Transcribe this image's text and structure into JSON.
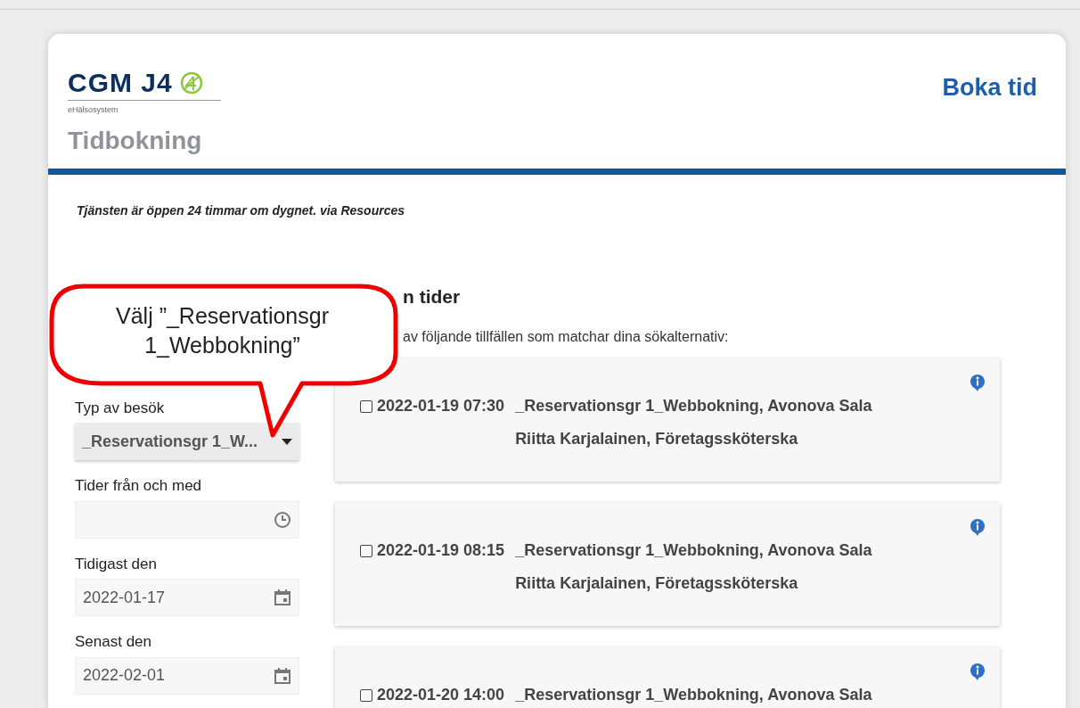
{
  "header": {
    "logo_text": "CGM J4",
    "logo_subtitle": "eHälsosystem",
    "title": "Tidbokning",
    "action_link": "Boka tid"
  },
  "notice": "Tjänsten är öppen 24 timmar om dygnet. via Resources",
  "results": {
    "heading": "n tider",
    "intro": "av följande tillfällen som matchar dina sökalternativ:"
  },
  "filters": [
    {
      "kind": "select",
      "label": "Typ av besök",
      "value": "_Reservationsgr 1_W..."
    },
    {
      "kind": "time",
      "label": "Tider från och med"
    },
    {
      "kind": "date",
      "label": "Tidigast den",
      "value": "2022-01-17"
    },
    {
      "kind": "date",
      "label": "Senast den",
      "value": "2022-02-01"
    }
  ],
  "slots": [
    {
      "checked": false,
      "datetime": "2022-01-19 07:30",
      "service": "_Reservationsgr 1_Webbokning, Avonova Sala",
      "staff": "Riitta Karjalainen, Företagssköterska"
    },
    {
      "checked": false,
      "datetime": "2022-01-19 08:15",
      "service": "_Reservationsgr 1_Webbokning, Avonova Sala",
      "staff": "Riitta Karjalainen, Företagssköterska"
    },
    {
      "checked": false,
      "datetime": "2022-01-20 14:00",
      "service": "_Reservationsgr 1_Webbokning, Avonova Sala"
    }
  ],
  "callout": {
    "text": "Välj ”_Reservationsgr 1_Webbokning”"
  }
}
